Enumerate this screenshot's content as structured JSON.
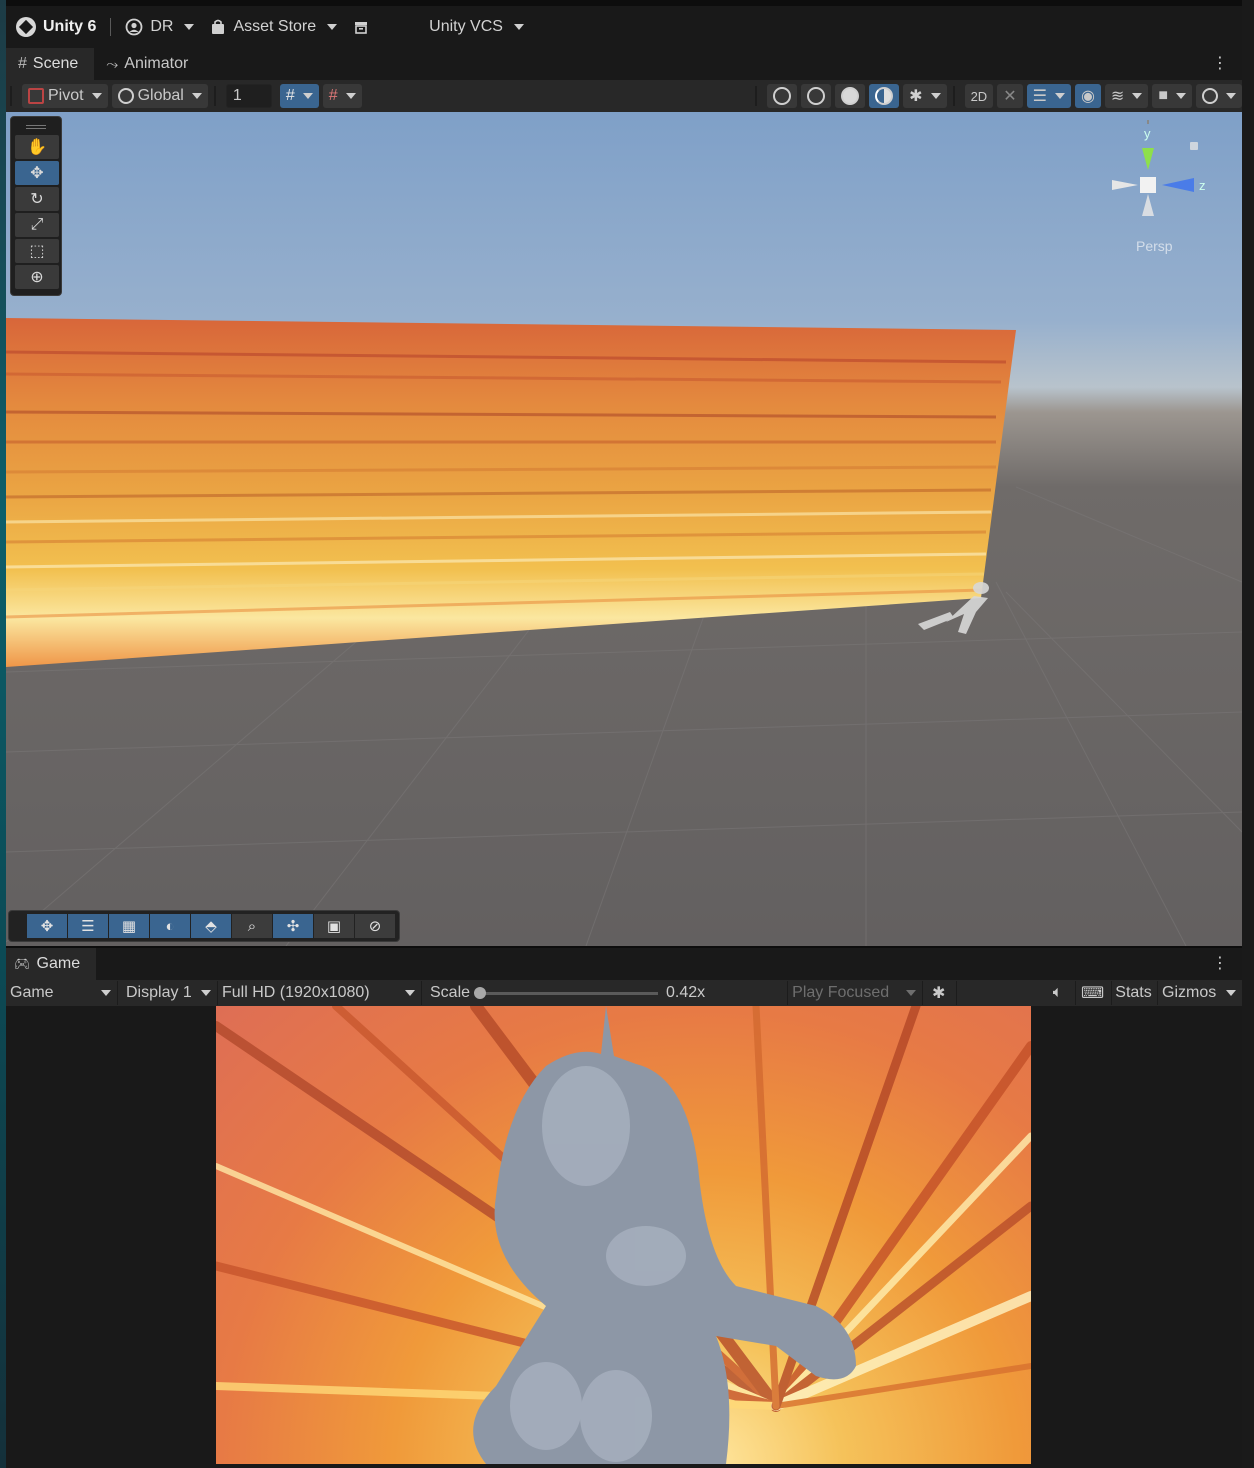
{
  "topbar": {
    "product": "Unity 6",
    "account": "DR",
    "asset_store": "Asset Store",
    "vcs": "Unity VCS",
    "icons": [
      "unity-logo-icon",
      "account-icon",
      "bag-icon",
      "package-icon"
    ]
  },
  "scene_tabs": [
    {
      "label": "Scene",
      "icon": "grid-icon",
      "active": true
    },
    {
      "label": "Animator",
      "icon": "animator-icon",
      "active": false
    }
  ],
  "scene_toolbar": {
    "pivot": "Pivot",
    "global": "Global",
    "grid_value": "1"
  },
  "palette": [
    "hand-tool",
    "move-tool",
    "rotate-tool",
    "scale-tool",
    "rect-tool",
    "transform-tool"
  ],
  "gizmo": {
    "y_label": "y",
    "z_label": "z",
    "projection": "Persp"
  },
  "game_tab": {
    "label": "Game",
    "icon": "gamepad-icon"
  },
  "game_toolbar": {
    "mode": "Game",
    "display": "Display 1",
    "resolution": "Full HD (1920x1080)",
    "scale_label": "Scale",
    "scale_value": "0.42x",
    "scale_fraction": 0.0,
    "play_focused": "Play Focused",
    "stats": "Stats",
    "gizmos": "Gizmos"
  },
  "colors": {
    "accent": "#3a6590",
    "panel": "#282828",
    "header": "#191919",
    "wall_orange": "#e98a3c",
    "wall_yellow": "#f7c64f"
  }
}
